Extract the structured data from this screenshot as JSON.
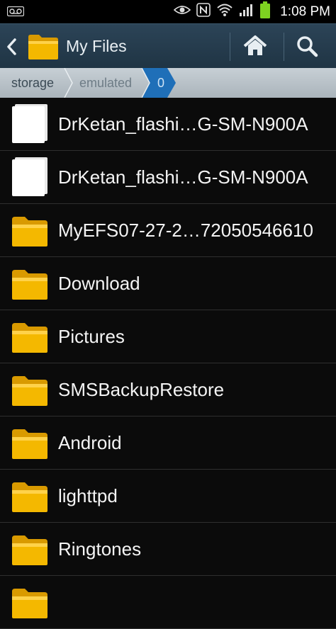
{
  "status_bar": {
    "time": "1:08 PM",
    "icons": [
      "voicemail-icon",
      "eye-icon",
      "nfc-icon",
      "wifi-icon",
      "signal-icon",
      "battery-icon"
    ]
  },
  "action_bar": {
    "title": "My Files",
    "back_icon": "chevron-left-icon",
    "home_icon": "home-icon",
    "search_icon": "search-icon"
  },
  "breadcrumb": [
    "storage",
    "emulated",
    "0"
  ],
  "files": [
    {
      "name": "DrKetan_flashi…G-SM-N900A",
      "type": "file"
    },
    {
      "name": "DrKetan_flashi…G-SM-N900A",
      "type": "file"
    },
    {
      "name": "MyEFS07-27-2…72050546610",
      "type": "folder"
    },
    {
      "name": "Download",
      "type": "folder"
    },
    {
      "name": "Pictures",
      "type": "folder"
    },
    {
      "name": "SMSBackupRestore",
      "type": "folder"
    },
    {
      "name": "Android",
      "type": "folder"
    },
    {
      "name": "lighttpd",
      "type": "folder"
    },
    {
      "name": "Ringtones",
      "type": "folder"
    },
    {
      "name": "",
      "type": "folder"
    }
  ],
  "colors": {
    "action_bar": "#2a4152",
    "breadcrumb": "#b8c1c8",
    "breadcrumb_active": "#2b78c2",
    "folder": "#f2b400",
    "background": "#0b0b0b"
  }
}
